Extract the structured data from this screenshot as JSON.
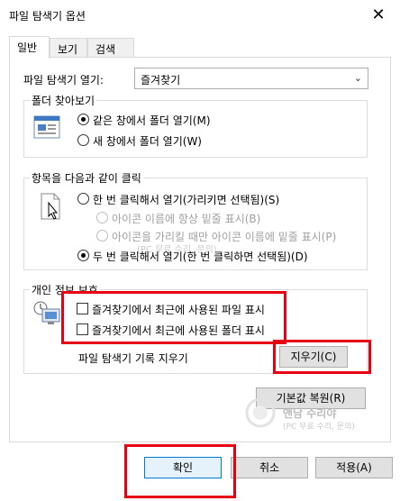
{
  "window": {
    "title": "파일 탐색기 옵션",
    "close_glyph": "✕"
  },
  "tabs": [
    {
      "label": "일반",
      "active": true
    },
    {
      "label": "보기",
      "active": false
    },
    {
      "label": "검색",
      "active": false
    }
  ],
  "open_explorer": {
    "label": "파일 탐색기 열기:",
    "value": "즐겨찾기"
  },
  "browse_folders": {
    "legend": "폴더 찾아보기",
    "options": [
      {
        "label": "같은 창에서 폴더 열기(M)",
        "selected": true
      },
      {
        "label": "새 창에서 폴더 열기(W)",
        "selected": false
      }
    ]
  },
  "click_items": {
    "legend": "항목을 다음과 같이 클릭",
    "options": [
      {
        "label": "한 번 클릭해서 열기(가리키면 선택됨)(S)",
        "selected": false,
        "disabled": false
      },
      {
        "label": "아이콘 이름에 항상 밑줄 표시(B)",
        "selected": false,
        "disabled": true
      },
      {
        "label": "아이콘을 가리킬 때만 아이콘 이름에 밑줄 표시(P)",
        "selected": false,
        "disabled": true
      },
      {
        "label": "두 번 클릭해서 열기(한 번 클릭하면 선택됨)(D)",
        "selected": true,
        "disabled": false
      }
    ]
  },
  "privacy": {
    "legend": "개인 정보 보호",
    "checks": [
      {
        "label": "즐겨찾기에서 최근에 사용된 파일 표시",
        "checked": false
      },
      {
        "label": "즐겨찾기에서 최근에 사용된 폴더 표시",
        "checked": false
      }
    ],
    "clear_label": "파일 탐색기 기록 지우기",
    "clear_button": "지우기(C)"
  },
  "restore_button": "기본값 복원(R)",
  "watermark": {
    "line1": "PC",
    "line2": "(PC 무료 수리, 문의)",
    "brand": "앤남 수리야",
    "brand_sub": "(PC 무료 수리, 문의)"
  },
  "footer": {
    "ok": "확인",
    "cancel": "취소",
    "apply": "적용(A)"
  },
  "colors": {
    "highlight": "#e60012",
    "accent": "#0078d7"
  }
}
